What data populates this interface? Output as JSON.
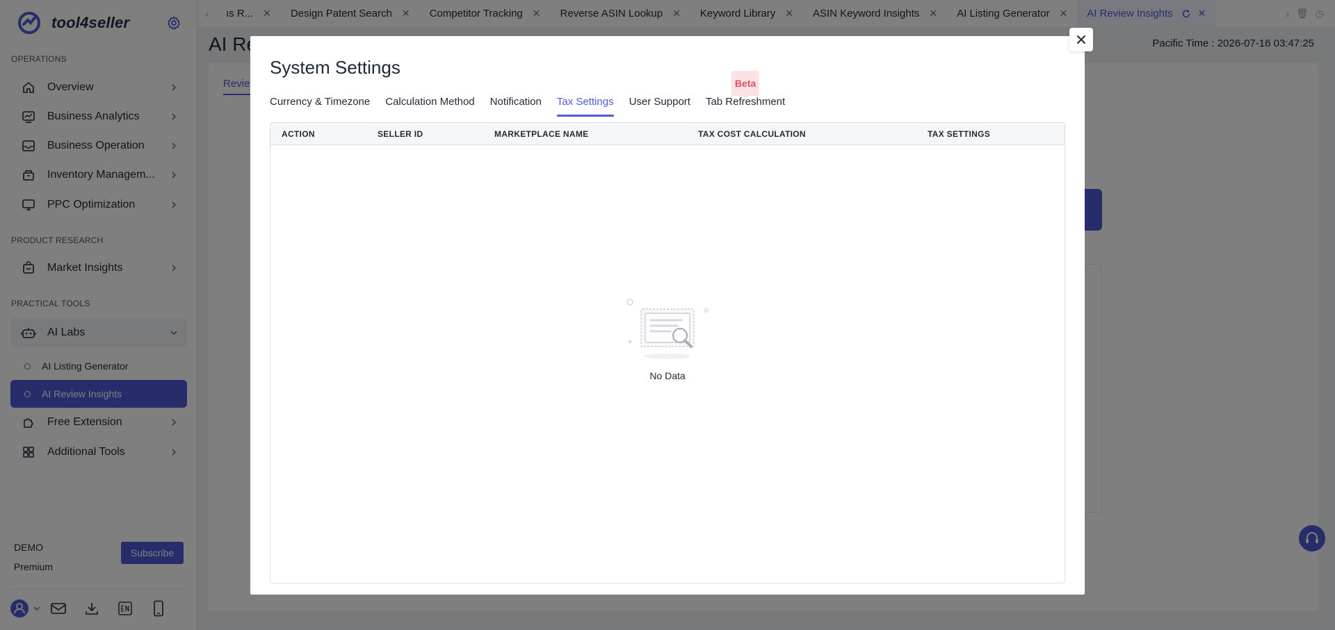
{
  "brand": {
    "name": "tool4seller"
  },
  "sidebar": {
    "sections": [
      {
        "label": "OPERATIONS"
      },
      {
        "label": "PRODUCT RESEARCH"
      },
      {
        "label": "PRACTICAL TOOLS"
      }
    ],
    "items": [
      {
        "label": "Overview",
        "icon": "home-icon"
      },
      {
        "label": "Business Analytics",
        "icon": "chart-icon"
      },
      {
        "label": "Business Operation",
        "icon": "inbox-icon"
      },
      {
        "label": "Inventory Managem...",
        "icon": "box-icon"
      },
      {
        "label": "PPC Optimization",
        "icon": "monitor-icon"
      },
      {
        "label": "Market Insights",
        "icon": "bag-icon"
      },
      {
        "label": "AI Labs",
        "icon": "robot-icon"
      },
      {
        "label": "Free Extension",
        "icon": "puzzle-icon"
      },
      {
        "label": "Additional Tools",
        "icon": "grid-icon"
      }
    ],
    "subitems": [
      {
        "label": "AI Listing Generator"
      },
      {
        "label": "AI Review Insights"
      }
    ],
    "account": {
      "user": "DEMO",
      "plan": "Premium",
      "subscribe_label": "Subscribe"
    }
  },
  "tabs": [
    {
      "label": "ıs R..."
    },
    {
      "label": "Design Patent Search"
    },
    {
      "label": "Competitor Tracking"
    },
    {
      "label": "Reverse ASIN Lookup"
    },
    {
      "label": "Keyword Library"
    },
    {
      "label": "ASIN Keyword Insights"
    },
    {
      "label": "AI Listing Generator"
    },
    {
      "label": "AI Review Insights"
    }
  ],
  "page": {
    "title": "AI Re",
    "pacific_time": "Pacific Time :  2026-07-16 03:47:25",
    "subtab": "Review"
  },
  "modal": {
    "title": "System Settings",
    "tabs": [
      {
        "label": "Currency & Timezone"
      },
      {
        "label": "Calculation Method"
      },
      {
        "label": "Notification"
      },
      {
        "label": "Tax Settings"
      },
      {
        "label": "User Support"
      },
      {
        "label": "Tab Refreshment"
      }
    ],
    "beta_label": "Beta",
    "table": {
      "columns": [
        "ACTION",
        "SELLER ID",
        "MARKETPLACE NAME",
        "TAX COST CALCULATION",
        "TAX SETTINGS"
      ]
    },
    "empty_text": "No Data"
  },
  "colors": {
    "accent": "#4f5bd5",
    "beta_bg": "#fde2e4",
    "beta_text": "#e04f5f"
  }
}
